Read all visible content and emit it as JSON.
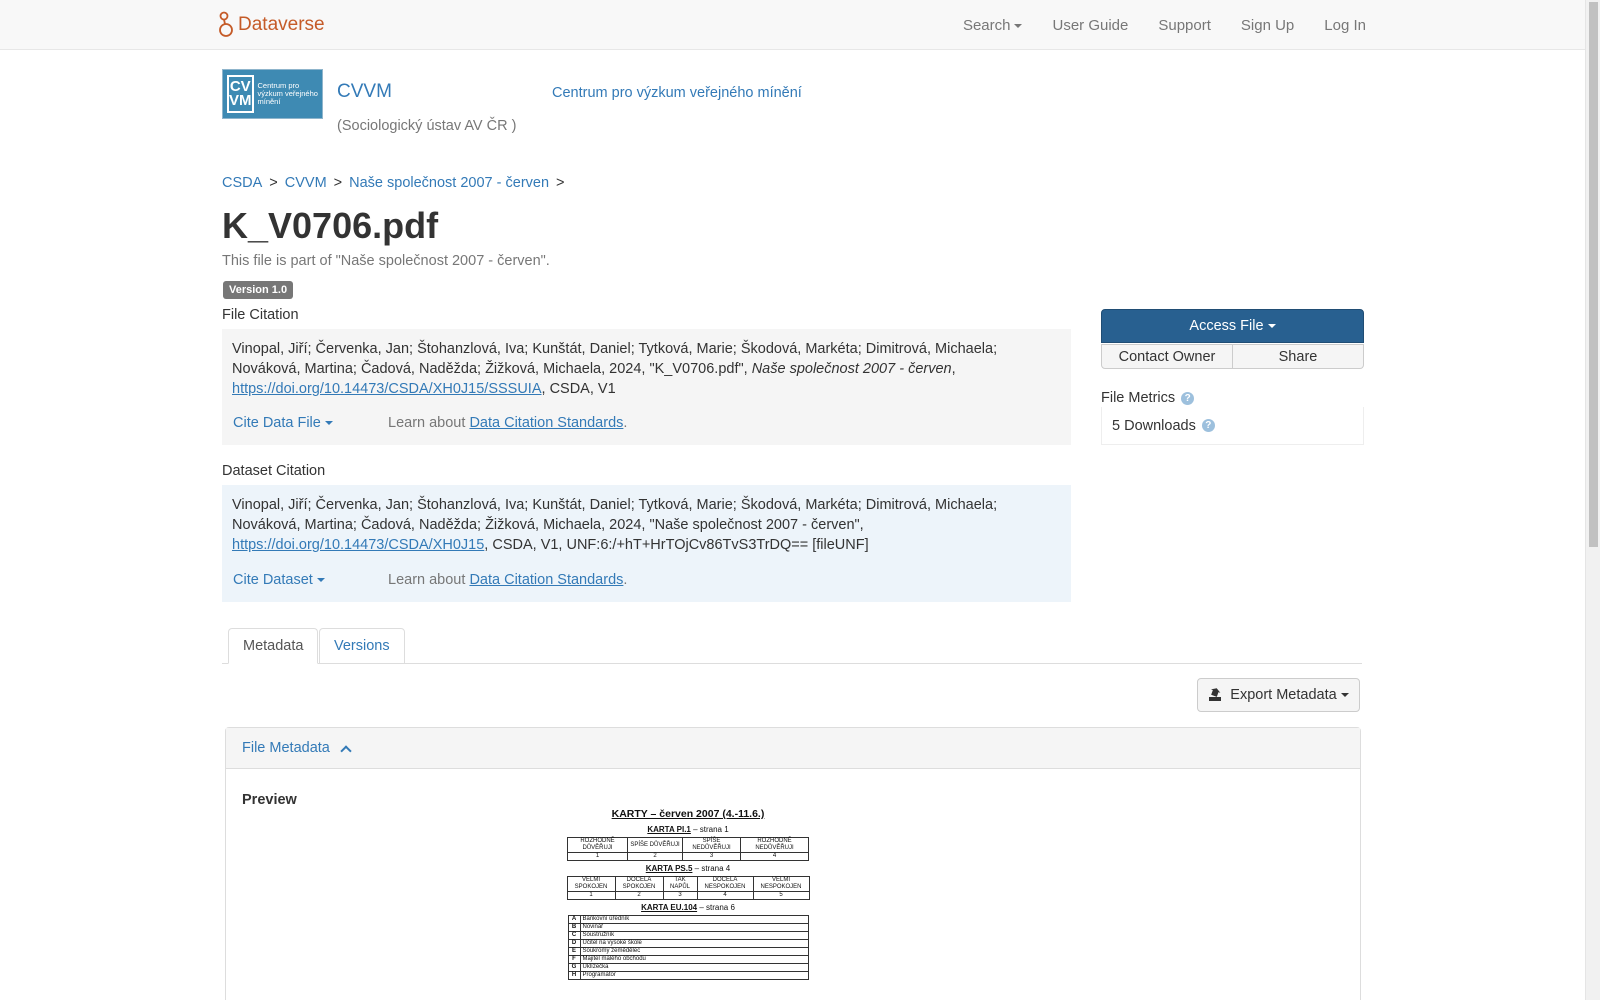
{
  "navbar": {
    "brand": "Dataverse",
    "links": [
      "Search",
      "User Guide",
      "Support",
      "Sign Up",
      "Log In"
    ]
  },
  "dataverse": {
    "logo_abbrev_top": "CV",
    "logo_abbrev_bottom": "VM",
    "logo_text": "Centrum pro výzkum veřejného mínění",
    "name": "CVVM",
    "affiliation": "(Sociologický ústav AV ČR )",
    "tagline": "Centrum pro výzkum veřejného mínění"
  },
  "breadcrumb": [
    "CSDA",
    "CVVM",
    "Naše společnost 2007 - červen"
  ],
  "breadcrumb_sep": ">",
  "file": {
    "title": "K_V0706.pdf",
    "part_of": "This file is part of \"Naše společnost 2007 - červen\".",
    "version": "Version 1.0"
  },
  "file_citation": {
    "label": "File Citation",
    "text_before": "Vinopal, Jiří; Červenka, Jan; Štohanzlová, Iva; Kunštát, Daniel; Tytková, Marie; Škodová, Markéta; Dimitrová, Michaela; Nováková, Martina; Čadová, Naděžda; Žižková, Michaela, 2024, \"K_V0706.pdf\", ",
    "text_italic": "Naše společnost 2007 - červen",
    "text_comma": ",",
    "doi": "https://doi.org/10.14473/CSDA/XH0J15/SSSUIA",
    "text_after": ", CSDA, V1",
    "cite_button": "Cite Data File",
    "learn_text": "Learn about ",
    "learn_link": "Data Citation Standards",
    "learn_end": "."
  },
  "dataset_citation": {
    "label": "Dataset Citation",
    "text_before": "Vinopal, Jiří; Červenka, Jan; Štohanzlová, Iva; Kunštát, Daniel; Tytková, Marie; Škodová, Markéta; Dimitrová, Michaela; Nováková, Martina; Čadová, Naděžda; Žižková, Michaela, 2024, \"Naše společnost 2007 - červen\", ",
    "doi": "https://doi.org/10.14473/CSDA/XH0J15",
    "text_after": ", CSDA, V1, UNF:6:/+hT+HrTOjCv86TvS3TrDQ== [fileUNF]",
    "cite_button": "Cite Dataset",
    "learn_text": "Learn about ",
    "learn_link": "Data Citation Standards",
    "learn_end": "."
  },
  "actions": {
    "access_file": "Access File",
    "contact_owner": "Contact Owner",
    "share": "Share"
  },
  "metrics": {
    "label": "File Metrics",
    "downloads": "5 Downloads",
    "help_glyph": "?"
  },
  "tabs": [
    "Metadata",
    "Versions"
  ],
  "export_button": "Export Metadata",
  "panel": {
    "title": "File Metadata",
    "preview_label": "Preview"
  },
  "preview_doc": {
    "title": "KARTY – červen 2007 (4.-11.6.)",
    "card1_label": "KARTA PI.1",
    "card1_page": " – strana 1",
    "card1_cols": [
      "ROZHODNĚ DŮVĚŘUJI",
      "SPÍŠE DŮVĚŘUJI",
      "SPÍŠE NEDŮVĚŘUJI",
      "ROZHODNĚ NEDŮVĚŘUJI"
    ],
    "card1_nums": [
      "1",
      "2",
      "3",
      "4"
    ],
    "card2_label": "KARTA PS.5",
    "card2_page": " – strana 4",
    "card2_cols": [
      "VELMI SPOKOJEN",
      "DOCELA SPOKOJEN",
      "TAK NAPŮL",
      "DOCELA NESPOKOJEN",
      "VELMI NESPOKOJEN"
    ],
    "card2_nums": [
      "1",
      "2",
      "3",
      "4",
      "5"
    ],
    "card3_label": "KARTA EU.104",
    "card3_page": " – strana 6",
    "card3_rows": [
      {
        "k": "A",
        "v": "Bankovní úředník"
      },
      {
        "k": "B",
        "v": "Novinář"
      },
      {
        "k": "C",
        "v": "Soustružník"
      },
      {
        "k": "D",
        "v": "Učitel na vysoké škole"
      },
      {
        "k": "E",
        "v": "Soukromý zemědělec"
      },
      {
        "k": "F",
        "v": "Majitel malého obchodu"
      },
      {
        "k": "G",
        "v": "Uklízečka"
      },
      {
        "k": "H",
        "v": "Programátor"
      }
    ]
  },
  "colors": {
    "brand": "#c55b28",
    "link": "#337ab7",
    "primary_button": "#286090"
  }
}
